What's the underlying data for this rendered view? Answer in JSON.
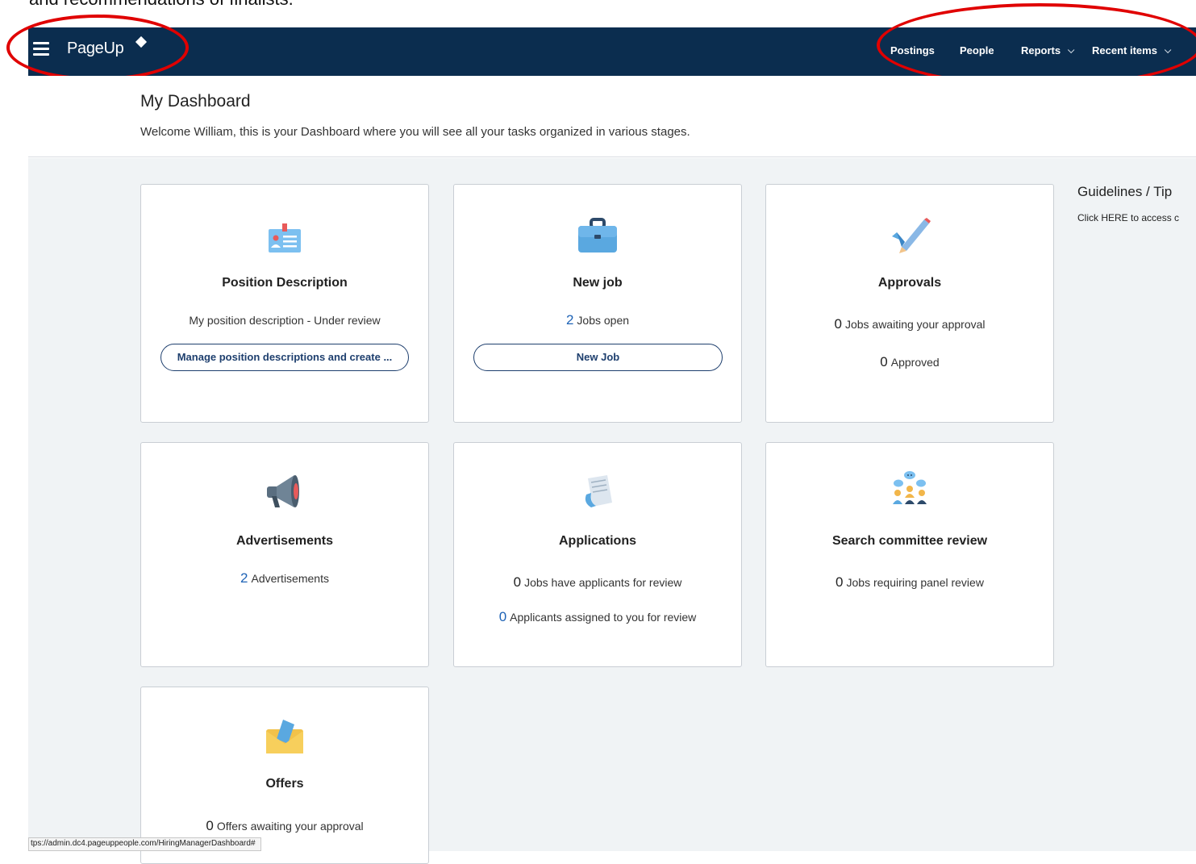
{
  "top_text": "and recommendations of finalists.",
  "nav": {
    "logo": "PageUp",
    "items": [
      {
        "label": "Postings"
      },
      {
        "label": "People"
      },
      {
        "label": "Reports"
      },
      {
        "label": "Recent items"
      }
    ]
  },
  "header": {
    "title": "My Dashboard",
    "welcome": "Welcome William, this is your Dashboard where you will see all your tasks organized in various stages."
  },
  "cards": [
    {
      "title": "Position Description",
      "line1": "My position description - Under review",
      "button": "Manage position descriptions and create ...",
      "icon": "id-badge-icon"
    },
    {
      "title": "New job",
      "line1_num": "2",
      "line1_text": "Jobs open",
      "button": "New Job",
      "icon": "briefcase-icon"
    },
    {
      "title": "Approvals",
      "line1_num": "0",
      "line1_text": "Jobs awaiting your approval",
      "line2_num": "0",
      "line2_text": "Approved",
      "icon": "checkmark-pencil-icon"
    },
    {
      "title": "Advertisements",
      "line1_num": "2",
      "line1_text": "Advertisements",
      "icon": "megaphone-icon"
    },
    {
      "title": "Applications",
      "line1_num": "0",
      "line1_text": "Jobs have applicants for review",
      "line2_num": "0",
      "line2_text": "Applicants assigned to you for review",
      "icon": "document-icon"
    },
    {
      "title": "Search committee review",
      "line1_num": "0",
      "line1_text": "Jobs requiring panel review",
      "icon": "committee-people-icon"
    },
    {
      "title": "Offers",
      "line1_num": "0",
      "line1_text": "Offers awaiting your approval",
      "icon": "envelope-icon"
    }
  ],
  "guidelines": {
    "title": "Guidelines / Tip",
    "text": "Click HERE to access c"
  },
  "status_url": "tps://admin.dc4.pageuppeople.com/HiringManagerDashboard#",
  "colors": {
    "navbar": "#0b2d4f",
    "link_number": "#1e63b6",
    "annotation": "#e00000",
    "content_bg": "#f0f3f5"
  }
}
